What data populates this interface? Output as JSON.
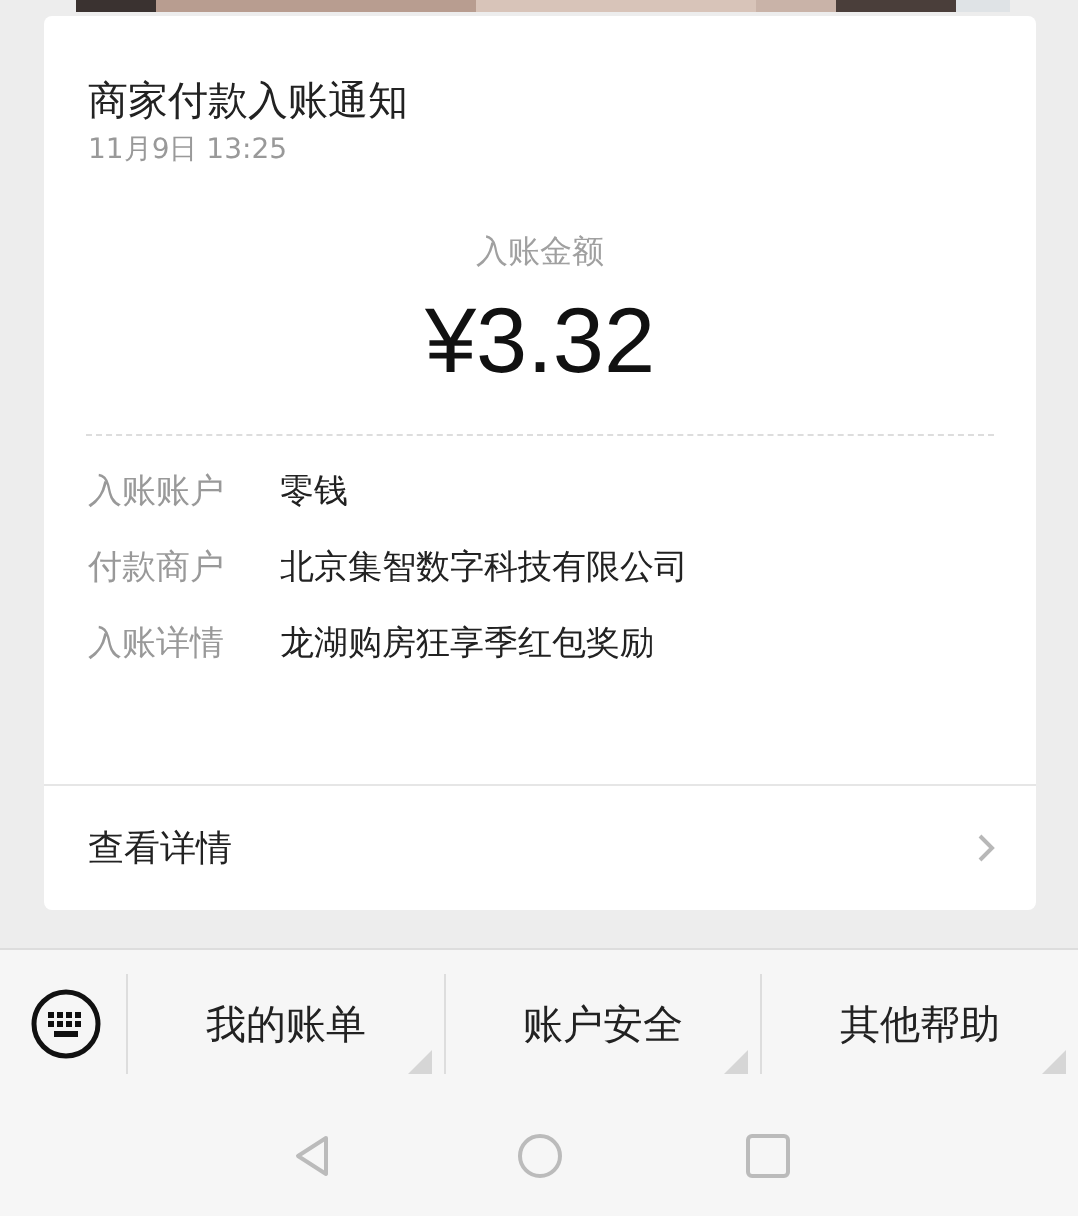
{
  "card": {
    "title": "商家付款入账通知",
    "time": "11月9日  13:25",
    "amount_label": "入账金额",
    "amount": "¥3.32",
    "fields": [
      {
        "label": "入账账户",
        "value": "零钱"
      },
      {
        "label": "付款商户",
        "value": "北京集智数字科技有限公司"
      },
      {
        "label": "入账详情",
        "value": "龙湖购房狂享季红包奖励"
      }
    ],
    "link": "查看详情"
  },
  "menu": {
    "items": [
      "我的账单",
      "账户安全",
      "其他帮助"
    ]
  }
}
